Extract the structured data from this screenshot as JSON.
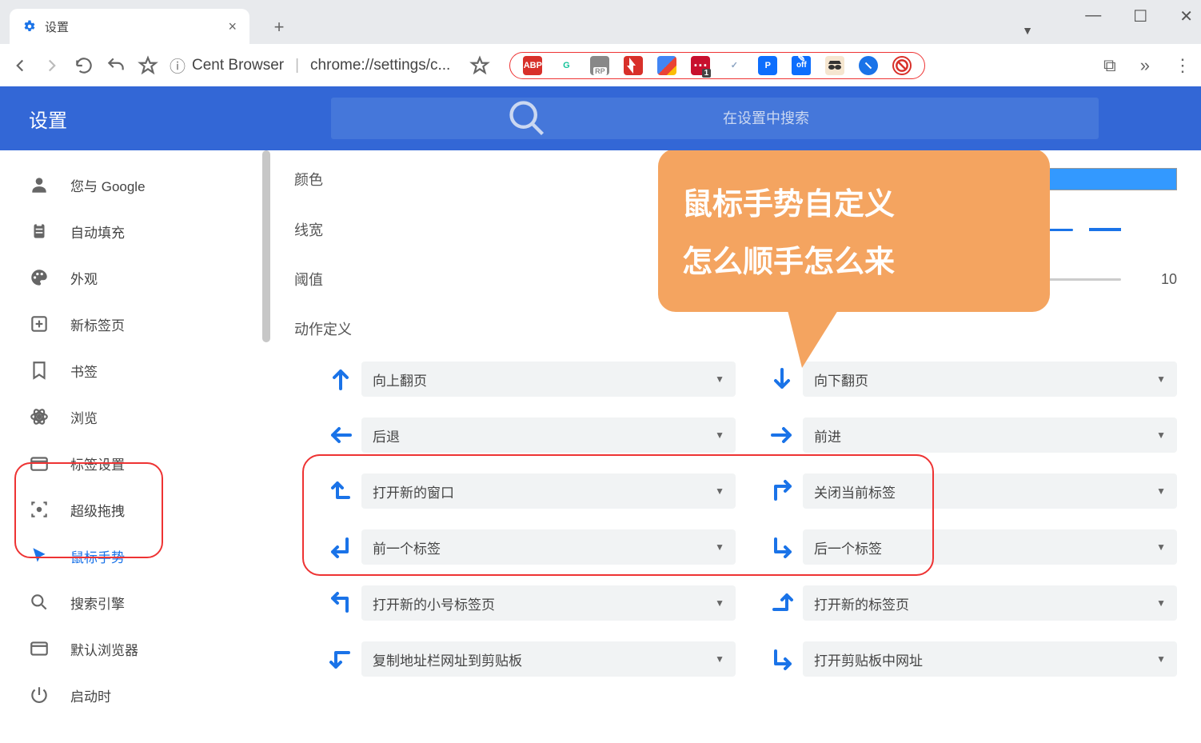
{
  "browser": {
    "tab_title": "设置",
    "address_prefix": "Cent Browser",
    "address_url": "chrome://settings/c...",
    "extensions": [
      {
        "name": "abp",
        "bg": "#d8302a",
        "txt": "ABP",
        "fg": "#fff"
      },
      {
        "name": "grammarly",
        "bg": "#fff",
        "txt": "G",
        "fg": "#15c39a",
        "round": true
      },
      {
        "name": "axure",
        "bg": "#777",
        "txt": "",
        "fg": "#fff"
      },
      {
        "name": "flash",
        "bg": "#d8302a",
        "txt": "",
        "fg": "#fff"
      },
      {
        "name": "colorful",
        "bg": "linear",
        "txt": "",
        "fg": ""
      },
      {
        "name": "lastpass",
        "bg": "#c8102e",
        "txt": "",
        "fg": "#fff"
      },
      {
        "name": "check",
        "bg": "transparent",
        "txt": "✓",
        "fg": "#8aa3c2"
      },
      {
        "name": "p",
        "bg": "#0d6efd",
        "txt": "P",
        "fg": "#fff"
      },
      {
        "name": "off",
        "bg": "#0d6efd",
        "txt": "off",
        "fg": "#fff"
      },
      {
        "name": "incognito",
        "bg": "#5e4b3c",
        "txt": "",
        "fg": "#fff"
      },
      {
        "name": "blue-circle",
        "bg": "#1a73e8",
        "txt": "",
        "fg": "",
        "round": true
      },
      {
        "name": "noscript",
        "bg": "#fff",
        "txt": "",
        "fg": "#d8302a",
        "round": true
      }
    ]
  },
  "header": {
    "title": "设置",
    "search_placeholder": "在设置中搜索"
  },
  "sidebar": {
    "items": [
      {
        "label": "您与 Google",
        "icon": "person"
      },
      {
        "label": "自动填充",
        "icon": "clipboard"
      },
      {
        "label": "外观",
        "icon": "palette"
      },
      {
        "label": "新标签页",
        "icon": "plus-box"
      },
      {
        "label": "书签",
        "icon": "bookmark"
      },
      {
        "label": "浏览",
        "icon": "atom"
      },
      {
        "label": "标签设置",
        "icon": "tab"
      },
      {
        "label": "超级拖拽",
        "icon": "target"
      },
      {
        "label": "鼠标手势",
        "icon": "cursor",
        "active": true
      },
      {
        "label": "搜索引擎",
        "icon": "search"
      },
      {
        "label": "默认浏览器",
        "icon": "browser"
      },
      {
        "label": "启动时",
        "icon": "power"
      }
    ]
  },
  "settings": {
    "color_label": "颜色",
    "color_value": "3399FF",
    "width_label": "线宽",
    "threshold_label": "阈值",
    "threshold_value": "10",
    "section_title": "动作定义",
    "gestures": [
      {
        "dir": "up",
        "action": "向上翻页"
      },
      {
        "dir": "down",
        "action": "向下翻页"
      },
      {
        "dir": "left",
        "action": "后退"
      },
      {
        "dir": "right",
        "action": "前进"
      },
      {
        "dir": "left-up",
        "action": "打开新的窗口"
      },
      {
        "dir": "up-right",
        "action": "关闭当前标签"
      },
      {
        "dir": "down-left",
        "action": "前一个标签"
      },
      {
        "dir": "down-right-l",
        "action": "后一个标签"
      },
      {
        "dir": "up-left",
        "action": "打开新的小号标签页"
      },
      {
        "dir": "right-up",
        "action": "打开新的标签页"
      },
      {
        "dir": "left-down",
        "action": "复制地址栏网址到剪贴板"
      },
      {
        "dir": "down-right",
        "action": "打开剪贴板中网址"
      }
    ]
  },
  "annotation": {
    "line1": "鼠标手势自定义",
    "line2": "怎么顺手怎么来"
  }
}
